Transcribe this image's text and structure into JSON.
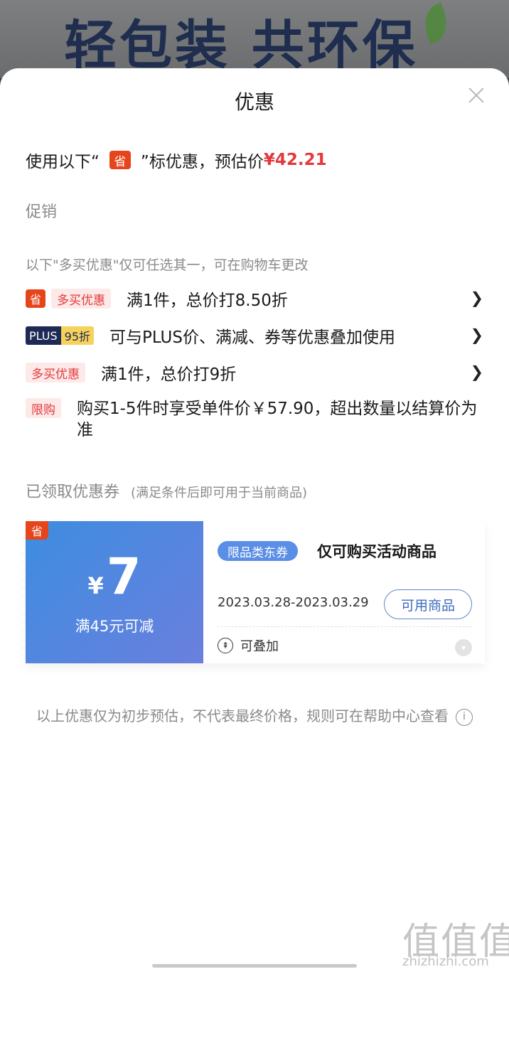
{
  "background": {
    "banner_text": "轻包装  共环保"
  },
  "sheet": {
    "title": "优惠",
    "estimate": {
      "prefix": "使用以下“",
      "badge": "省",
      "suffix": "”标优惠，预估价",
      "price": "¥42.21"
    },
    "promotion_label": "促销",
    "note": "以下\"多买优惠\"仅可任选其一，可在购物车更改",
    "promotions": [
      {
        "tag_sheng": "省",
        "tag": "多买优惠",
        "text": "满1件，总价打8.50折"
      },
      {
        "tag_plus": "PLUS",
        "tag_discount": "95折",
        "text": "可与PLUS价、满减、券等优惠叠加使用"
      },
      {
        "tag": "多买优惠",
        "text": "满1件，总价打9折"
      }
    ],
    "limit": {
      "tag": "限购",
      "text": "购买1-5件时享受单件价￥57.90，超出数量以结算价为准"
    },
    "coupon_section": {
      "heading": "已领取优惠券",
      "subheading": "(满足条件后即可用于当前商品)"
    },
    "coupon": {
      "corner": "省",
      "currency": "¥",
      "amount": "7",
      "condition": "满45元可减",
      "category": "限品类东券",
      "title": "仅可购买活动商品",
      "dates": "2023.03.28-2023.03.29",
      "use_button": "可用商品",
      "stack_label": "可叠加"
    },
    "disclaimer": "以上优惠仅为初步预估，不代表最终价格，规则可在帮助中心查看"
  },
  "watermark": {
    "main": "值值值",
    "sub": "zhizhizhi.com"
  },
  "colors": {
    "accent_red": "#e4393c",
    "badge_orange": "#e6451c",
    "coupon_blue": "#3d8de0",
    "plus_navy": "#1d2a55",
    "plus_gold": "#f6d25a"
  }
}
